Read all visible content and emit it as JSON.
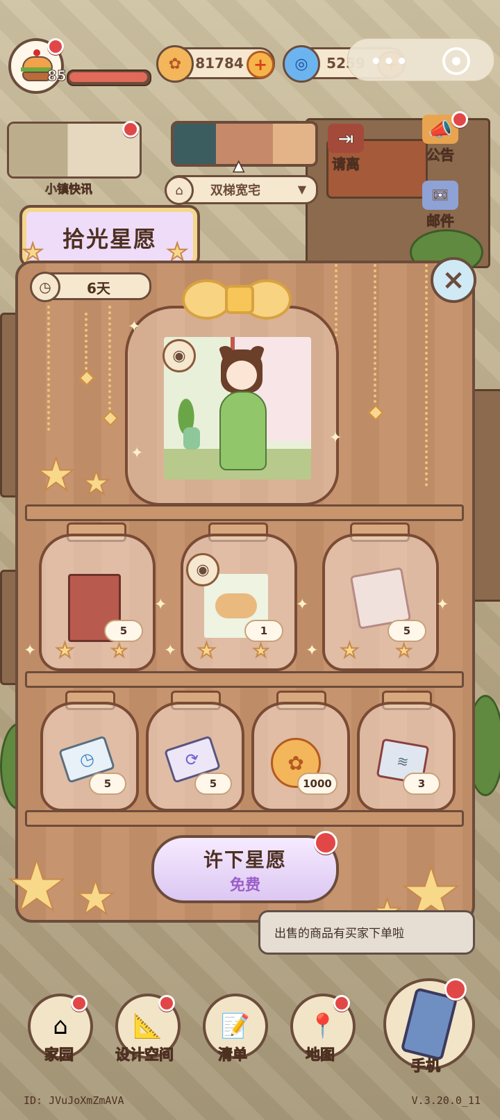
{
  "player": {
    "level": "85"
  },
  "currency": {
    "coins": "81784",
    "gems": "5259"
  },
  "news": {
    "label": "小镇快讯"
  },
  "house": {
    "name": "双梯宽宅"
  },
  "side": {
    "leave": "请离",
    "notice": "公告",
    "mail": "邮件"
  },
  "event": {
    "title": "拾光星愿",
    "timer": "6天",
    "rewards_row1": [
      {
        "name": "book",
        "count": "5"
      },
      {
        "name": "dog-with-plants",
        "count": "1"
      },
      {
        "name": "scroll",
        "count": "5"
      }
    ],
    "rewards_row2": [
      {
        "name": "clock-card",
        "count": "5"
      },
      {
        "name": "refresh-card",
        "count": "5"
      },
      {
        "name": "coin",
        "count": "1000"
      },
      {
        "name": "fish-box",
        "count": "3"
      }
    ],
    "wish_button": {
      "label": "许下星愿",
      "sub": "免费"
    }
  },
  "bubble": {
    "text": "出售的商品有买家下单啦"
  },
  "nav": {
    "home": "家园",
    "design": "设计空间",
    "list": "清单",
    "map": "地图",
    "phone": "手机"
  },
  "footer": {
    "uid": "ID:  JVuJoXmZmAVA",
    "version": "V.3.20.0_11"
  },
  "colors": {
    "panel": "#c5916b",
    "outline": "#6b4c3b",
    "badge_red": "#e24747",
    "wish_purple": "#9b5fc8"
  }
}
